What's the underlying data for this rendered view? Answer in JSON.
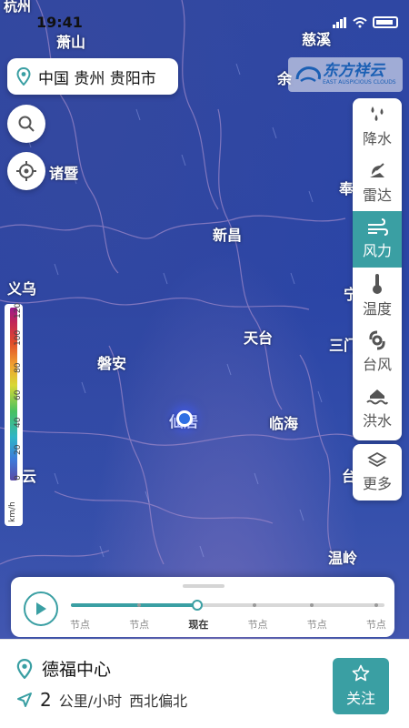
{
  "status_bar": {
    "time": "19:41",
    "carrier_city": "杭州"
  },
  "location": {
    "label": "中国 贵州 贵阳市"
  },
  "logo": {
    "main": "东方祥云",
    "sub": "EAST AUSPICIOUS CLOUDS"
  },
  "cities": [
    {
      "name": "杭州"
    },
    {
      "name": "萧山"
    },
    {
      "name": "慈溪"
    },
    {
      "name": "余"
    },
    {
      "name": "诸暨"
    },
    {
      "name": "奉"
    },
    {
      "name": "新昌"
    },
    {
      "name": "义乌"
    },
    {
      "name": "宁"
    },
    {
      "name": "天台"
    },
    {
      "name": "磐安"
    },
    {
      "name": "三门"
    },
    {
      "name": "仙居"
    },
    {
      "name": "临海"
    },
    {
      "name": "云"
    },
    {
      "name": "台"
    },
    {
      "name": "温岭"
    }
  ],
  "layers": [
    {
      "label": "降水",
      "icon": "precipitation-icon",
      "active": false
    },
    {
      "label": "雷达",
      "icon": "radar-icon",
      "active": false
    },
    {
      "label": "风力",
      "icon": "wind-icon",
      "active": true
    },
    {
      "label": "温度",
      "icon": "thermometer-icon",
      "active": false
    },
    {
      "label": "台风",
      "icon": "typhoon-icon",
      "active": false
    },
    {
      "label": "洪水",
      "icon": "flood-icon",
      "active": false
    }
  ],
  "more": {
    "label": "更多"
  },
  "legend": {
    "ticks": [
      "0",
      "20",
      "40",
      "60",
      "80",
      "100",
      "120"
    ],
    "unit": "km/h"
  },
  "timeline": {
    "labels": [
      "节点",
      "节点",
      "现在",
      "节点",
      "节点",
      "节点"
    ],
    "current_index": 2
  },
  "bottom": {
    "place": "德福中心",
    "wind_speed": "2",
    "wind_unit": "公里/小时",
    "wind_direction": "西北偏北",
    "follow_label": "关注"
  },
  "colors": {
    "accent": "#3a9fa3",
    "map_bg": "#2f47a3"
  }
}
